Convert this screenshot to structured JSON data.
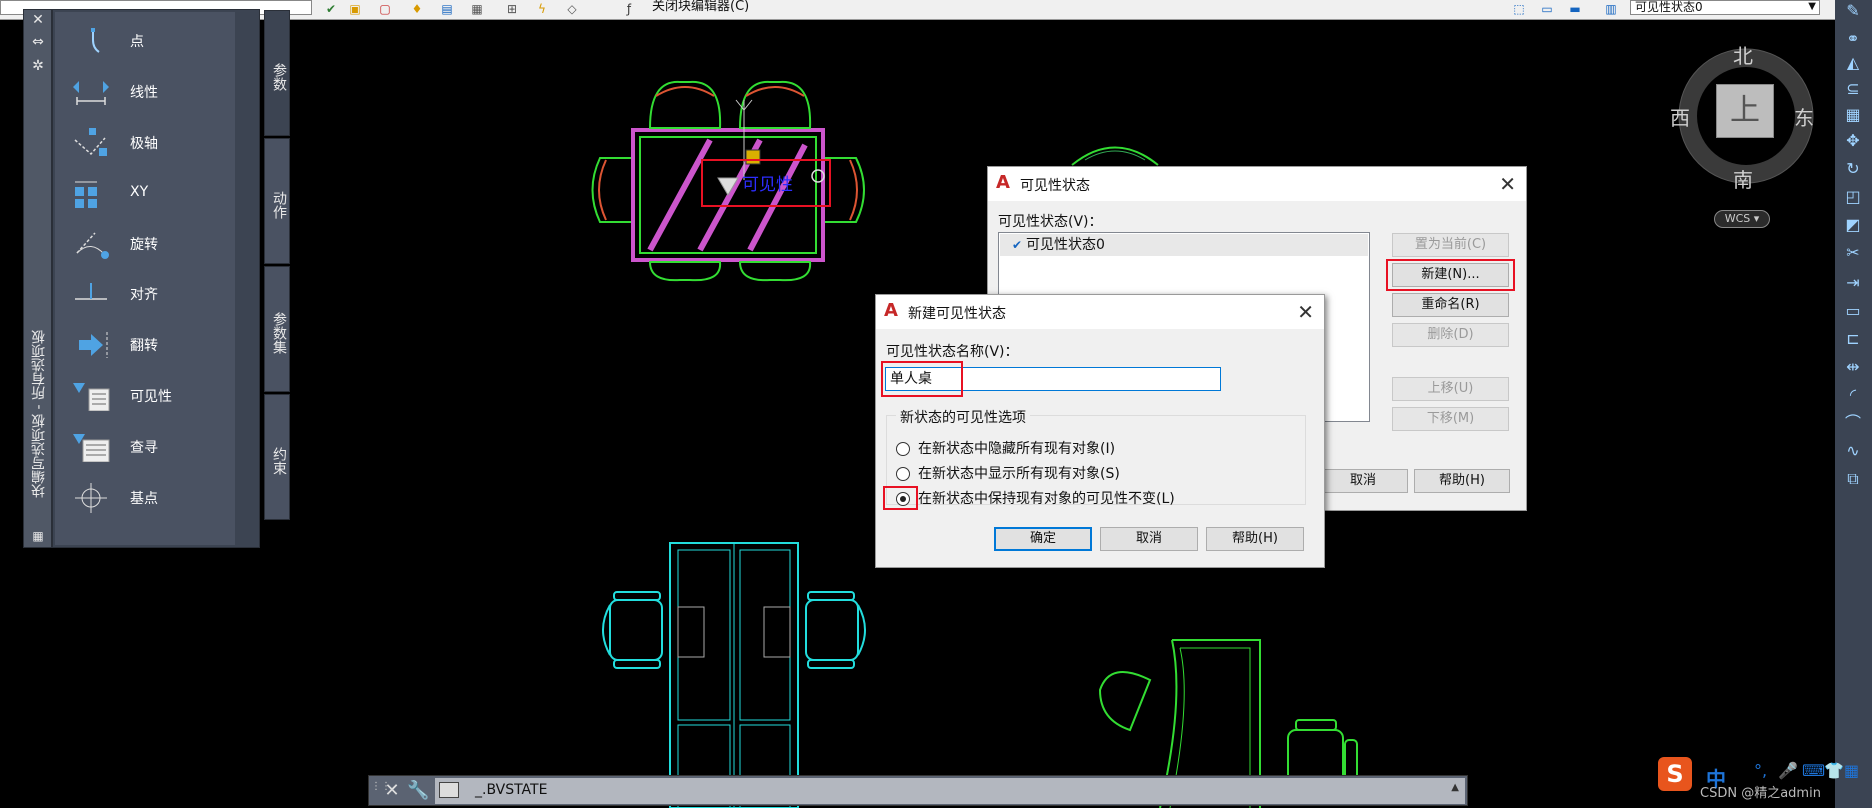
{
  "toolbar": {
    "close_block_editor_label": "关闭块编辑器(C)",
    "visibility_state_value": "可见性状态0",
    "dropdown_arrow": "▼"
  },
  "palette": {
    "title": "块编写选项板 - 所有选项板",
    "controls": [
      "✕",
      "⇔",
      "✲"
    ],
    "tabs": [
      "参数",
      "动作",
      "参数集",
      "约束"
    ],
    "active_tab": "参数",
    "items": [
      {
        "icon": "point-param-icon",
        "label": "点"
      },
      {
        "icon": "linear-param-icon",
        "label": "线性"
      },
      {
        "icon": "polar-param-icon",
        "label": "极轴"
      },
      {
        "icon": "xy-param-icon",
        "label": "XY"
      },
      {
        "icon": "rotation-param-icon",
        "label": "旋转"
      },
      {
        "icon": "alignment-param-icon",
        "label": "对齐"
      },
      {
        "icon": "flip-param-icon",
        "label": "翻转"
      },
      {
        "icon": "visibility-param-icon",
        "label": "可见性"
      },
      {
        "icon": "lookup-param-icon",
        "label": "查寻"
      },
      {
        "icon": "basepoint-param-icon",
        "label": "基点"
      }
    ]
  },
  "viewcube": {
    "north": "北",
    "south": "南",
    "east": "东",
    "west": "西",
    "top_face": "上",
    "wcs": "WCS"
  },
  "drawing": {
    "visibility_label": "可见性"
  },
  "visibility_dialog": {
    "title": "可见性状态",
    "list_label": "可见性状态(V)：",
    "states": [
      "可见性状态0"
    ],
    "buttons": {
      "set_current": "置为当前(C)",
      "new": "新建(N)...",
      "rename": "重命名(R)",
      "delete": "删除(D)",
      "move_up": "上移(U)",
      "move_down": "下移(M)",
      "cancel": "取消",
      "help": "帮助(H)"
    }
  },
  "new_state_dialog": {
    "title": "新建可见性状态",
    "name_label": "可见性状态名称(V)：",
    "name_value": "单人桌",
    "options_title": "新状态的可见性选项",
    "options": [
      {
        "label": "在新状态中隐藏所有现有对象(I)",
        "selected": false
      },
      {
        "label": "在新状态中显示所有现有对象(S)",
        "selected": false
      },
      {
        "label": "在新状态中保持现有对象的可见性不变(L)",
        "selected": true
      }
    ],
    "buttons": {
      "ok": "确定",
      "cancel": "取消",
      "help": "帮助(H)"
    }
  },
  "command_line": {
    "text": "_.BVSTATE",
    "close": "✕",
    "customize": "🔧"
  },
  "ime": {
    "logo": "S",
    "mode": "中"
  },
  "watermark": "CSDN @精之admin",
  "colors": {
    "cad_background": "#000000",
    "green_lines": "#33dd33",
    "cyan_lines": "#22dddd",
    "magenta_hatch": "#cc55cc",
    "accent_red": "#e81123",
    "accent_blue": "#0078d7"
  }
}
